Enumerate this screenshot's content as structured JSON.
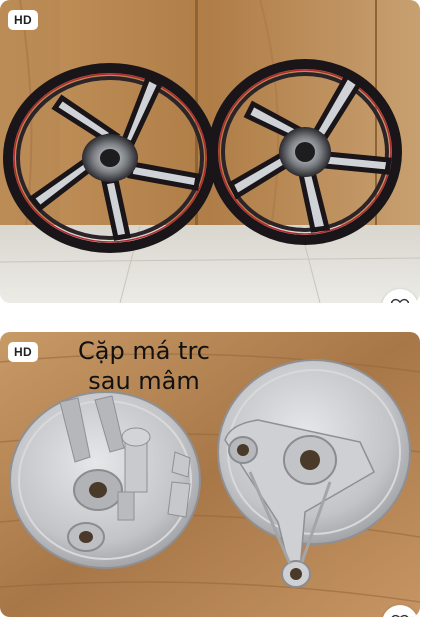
{
  "cards": [
    {
      "badge": "HD",
      "favorite_icon": "heart-outline-icon"
    },
    {
      "badge": "HD",
      "caption_line1": "Cặp má trc",
      "caption_line2": "sau mâm",
      "favorite_icon": "heart-outline-icon"
    }
  ],
  "colors": {
    "wood": "#b98a55",
    "wood_dark": "#8d6436",
    "rim": "#1a1518",
    "rim_red": "#b3272e",
    "aluminum": "#c9cacc"
  }
}
